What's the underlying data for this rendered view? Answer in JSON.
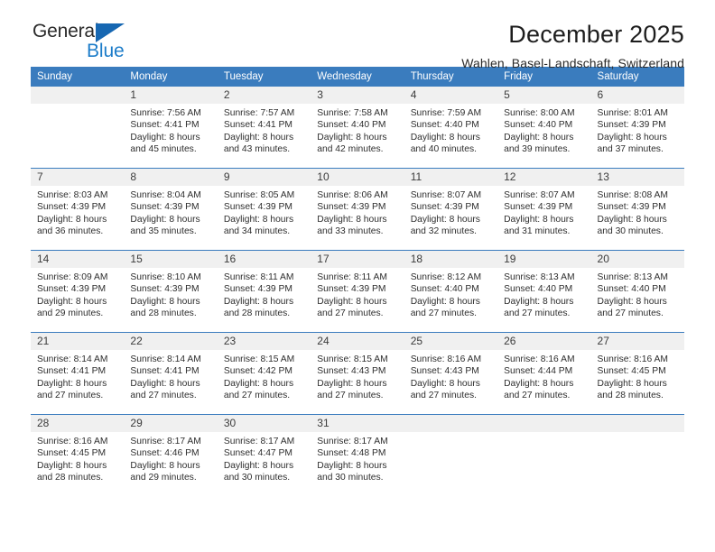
{
  "brand": {
    "name_top": "General",
    "name_bottom": "Blue",
    "triangle_color": "#1667b2",
    "blue_text_color": "#1c7cc9"
  },
  "header": {
    "title": "December 2025",
    "subtitle": "Wahlen, Basel-Landschaft, Switzerland"
  },
  "theme": {
    "header_blue": "#3a7cbe",
    "daynum_gray": "#f0f0f0",
    "text": "#2e2e2e"
  },
  "weekdays": [
    "Sunday",
    "Monday",
    "Tuesday",
    "Wednesday",
    "Thursday",
    "Friday",
    "Saturday"
  ],
  "labels": {
    "sunrise_prefix": "Sunrise:",
    "sunset_prefix": "Sunset:",
    "daylight_prefix": "Daylight:"
  },
  "weeks": [
    [
      {
        "day": "",
        "lines": []
      },
      {
        "day": "1",
        "lines": [
          "Sunrise: 7:56 AM",
          "Sunset: 4:41 PM",
          "Daylight: 8 hours",
          "and 45 minutes."
        ]
      },
      {
        "day": "2",
        "lines": [
          "Sunrise: 7:57 AM",
          "Sunset: 4:41 PM",
          "Daylight: 8 hours",
          "and 43 minutes."
        ]
      },
      {
        "day": "3",
        "lines": [
          "Sunrise: 7:58 AM",
          "Sunset: 4:40 PM",
          "Daylight: 8 hours",
          "and 42 minutes."
        ]
      },
      {
        "day": "4",
        "lines": [
          "Sunrise: 7:59 AM",
          "Sunset: 4:40 PM",
          "Daylight: 8 hours",
          "and 40 minutes."
        ]
      },
      {
        "day": "5",
        "lines": [
          "Sunrise: 8:00 AM",
          "Sunset: 4:40 PM",
          "Daylight: 8 hours",
          "and 39 minutes."
        ]
      },
      {
        "day": "6",
        "lines": [
          "Sunrise: 8:01 AM",
          "Sunset: 4:39 PM",
          "Daylight: 8 hours",
          "and 37 minutes."
        ]
      }
    ],
    [
      {
        "day": "7",
        "lines": [
          "Sunrise: 8:03 AM",
          "Sunset: 4:39 PM",
          "Daylight: 8 hours",
          "and 36 minutes."
        ]
      },
      {
        "day": "8",
        "lines": [
          "Sunrise: 8:04 AM",
          "Sunset: 4:39 PM",
          "Daylight: 8 hours",
          "and 35 minutes."
        ]
      },
      {
        "day": "9",
        "lines": [
          "Sunrise: 8:05 AM",
          "Sunset: 4:39 PM",
          "Daylight: 8 hours",
          "and 34 minutes."
        ]
      },
      {
        "day": "10",
        "lines": [
          "Sunrise: 8:06 AM",
          "Sunset: 4:39 PM",
          "Daylight: 8 hours",
          "and 33 minutes."
        ]
      },
      {
        "day": "11",
        "lines": [
          "Sunrise: 8:07 AM",
          "Sunset: 4:39 PM",
          "Daylight: 8 hours",
          "and 32 minutes."
        ]
      },
      {
        "day": "12",
        "lines": [
          "Sunrise: 8:07 AM",
          "Sunset: 4:39 PM",
          "Daylight: 8 hours",
          "and 31 minutes."
        ]
      },
      {
        "day": "13",
        "lines": [
          "Sunrise: 8:08 AM",
          "Sunset: 4:39 PM",
          "Daylight: 8 hours",
          "and 30 minutes."
        ]
      }
    ],
    [
      {
        "day": "14",
        "lines": [
          "Sunrise: 8:09 AM",
          "Sunset: 4:39 PM",
          "Daylight: 8 hours",
          "and 29 minutes."
        ]
      },
      {
        "day": "15",
        "lines": [
          "Sunrise: 8:10 AM",
          "Sunset: 4:39 PM",
          "Daylight: 8 hours",
          "and 28 minutes."
        ]
      },
      {
        "day": "16",
        "lines": [
          "Sunrise: 8:11 AM",
          "Sunset: 4:39 PM",
          "Daylight: 8 hours",
          "and 28 minutes."
        ]
      },
      {
        "day": "17",
        "lines": [
          "Sunrise: 8:11 AM",
          "Sunset: 4:39 PM",
          "Daylight: 8 hours",
          "and 27 minutes."
        ]
      },
      {
        "day": "18",
        "lines": [
          "Sunrise: 8:12 AM",
          "Sunset: 4:40 PM",
          "Daylight: 8 hours",
          "and 27 minutes."
        ]
      },
      {
        "day": "19",
        "lines": [
          "Sunrise: 8:13 AM",
          "Sunset: 4:40 PM",
          "Daylight: 8 hours",
          "and 27 minutes."
        ]
      },
      {
        "day": "20",
        "lines": [
          "Sunrise: 8:13 AM",
          "Sunset: 4:40 PM",
          "Daylight: 8 hours",
          "and 27 minutes."
        ]
      }
    ],
    [
      {
        "day": "21",
        "lines": [
          "Sunrise: 8:14 AM",
          "Sunset: 4:41 PM",
          "Daylight: 8 hours",
          "and 27 minutes."
        ]
      },
      {
        "day": "22",
        "lines": [
          "Sunrise: 8:14 AM",
          "Sunset: 4:41 PM",
          "Daylight: 8 hours",
          "and 27 minutes."
        ]
      },
      {
        "day": "23",
        "lines": [
          "Sunrise: 8:15 AM",
          "Sunset: 4:42 PM",
          "Daylight: 8 hours",
          "and 27 minutes."
        ]
      },
      {
        "day": "24",
        "lines": [
          "Sunrise: 8:15 AM",
          "Sunset: 4:43 PM",
          "Daylight: 8 hours",
          "and 27 minutes."
        ]
      },
      {
        "day": "25",
        "lines": [
          "Sunrise: 8:16 AM",
          "Sunset: 4:43 PM",
          "Daylight: 8 hours",
          "and 27 minutes."
        ]
      },
      {
        "day": "26",
        "lines": [
          "Sunrise: 8:16 AM",
          "Sunset: 4:44 PM",
          "Daylight: 8 hours",
          "and 27 minutes."
        ]
      },
      {
        "day": "27",
        "lines": [
          "Sunrise: 8:16 AM",
          "Sunset: 4:45 PM",
          "Daylight: 8 hours",
          "and 28 minutes."
        ]
      }
    ],
    [
      {
        "day": "28",
        "lines": [
          "Sunrise: 8:16 AM",
          "Sunset: 4:45 PM",
          "Daylight: 8 hours",
          "and 28 minutes."
        ]
      },
      {
        "day": "29",
        "lines": [
          "Sunrise: 8:17 AM",
          "Sunset: 4:46 PM",
          "Daylight: 8 hours",
          "and 29 minutes."
        ]
      },
      {
        "day": "30",
        "lines": [
          "Sunrise: 8:17 AM",
          "Sunset: 4:47 PM",
          "Daylight: 8 hours",
          "and 30 minutes."
        ]
      },
      {
        "day": "31",
        "lines": [
          "Sunrise: 8:17 AM",
          "Sunset: 4:48 PM",
          "Daylight: 8 hours",
          "and 30 minutes."
        ]
      },
      {
        "day": "",
        "lines": []
      },
      {
        "day": "",
        "lines": []
      },
      {
        "day": "",
        "lines": []
      }
    ]
  ]
}
